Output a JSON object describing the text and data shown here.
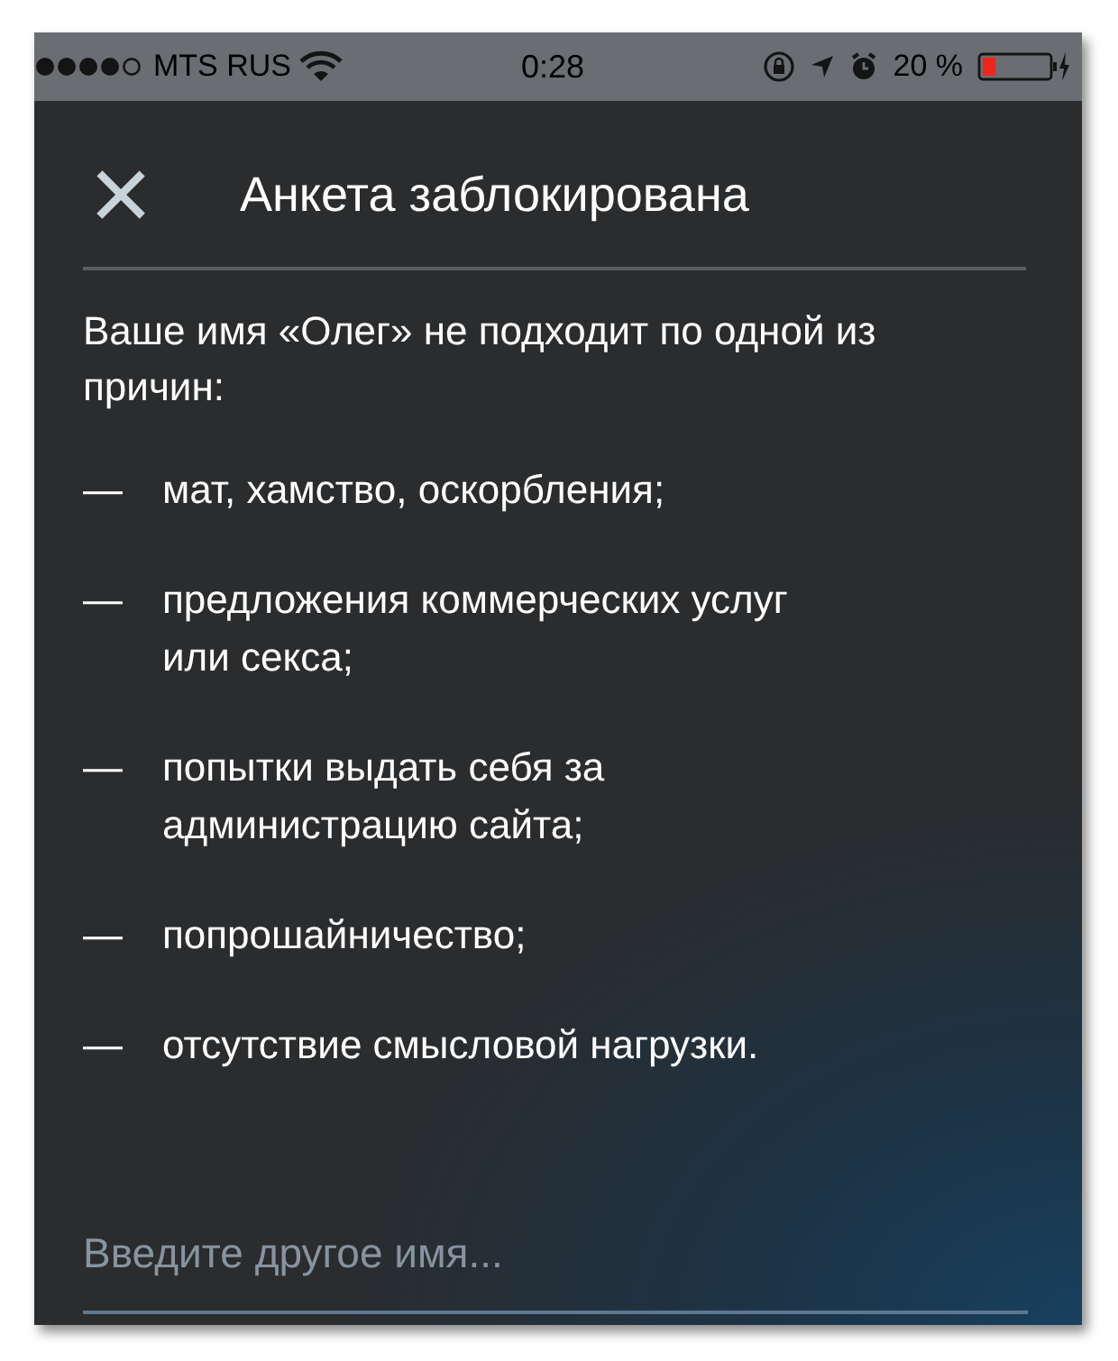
{
  "status_bar": {
    "carrier": "MTS RUS",
    "time": "0:28",
    "battery_percent": "20 %"
  },
  "header": {
    "close": "×",
    "title": "Анкета заблокирована"
  },
  "message": {
    "intro": "Ваше имя «Олег» не подходит по одной из причин:",
    "reasons": [
      {
        "dash": "—",
        "text": "мат, хамство, оскорбления;"
      },
      {
        "dash": "—",
        "text": "предложения коммерческих услуг или секса;"
      },
      {
        "dash": "—",
        "text": "попытки выдать себя за администрацию сайта;"
      },
      {
        "dash": "—",
        "text": "попрошайничество;"
      },
      {
        "dash": "—",
        "text": "отсутствие смысловой нагрузки."
      }
    ]
  },
  "name_field": {
    "placeholder": "Введите другое имя..."
  }
}
